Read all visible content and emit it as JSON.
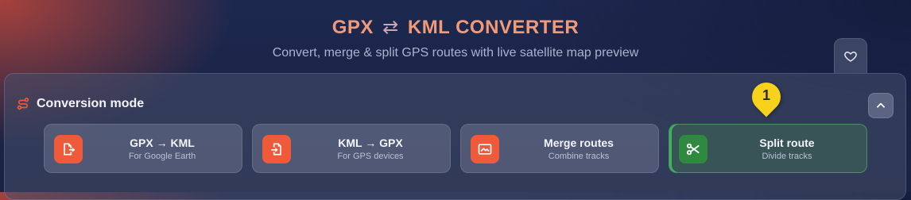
{
  "header": {
    "title_left": "GPX",
    "swap_glyph": "⇄",
    "title_right": "KML CONVERTER",
    "subtitle": "Convert, merge & split GPS routes with live satellite map preview"
  },
  "favorite": {
    "icon": "heart-icon"
  },
  "panel": {
    "title": "Conversion mode",
    "title_icon": "route-icon",
    "collapse_icon": "chevron-up-icon"
  },
  "modes": [
    {
      "label": "GPX → KML",
      "sub": "For Google Earth",
      "icon": "export-file-icon",
      "active": false
    },
    {
      "label": "KML → GPX",
      "sub": "For GPS devices",
      "icon": "import-file-icon",
      "active": false
    },
    {
      "label": "Merge routes",
      "sub": "Combine tracks",
      "icon": "merge-icon",
      "active": false
    },
    {
      "label": "Split route",
      "sub": "Divide tracks",
      "icon": "scissors-icon",
      "active": true
    }
  ],
  "marker": {
    "number": "1",
    "color": "#f6d21c"
  },
  "colors": {
    "accent": "#ee5a3a",
    "active": "#2f8a3f",
    "title": "#f29a78"
  }
}
